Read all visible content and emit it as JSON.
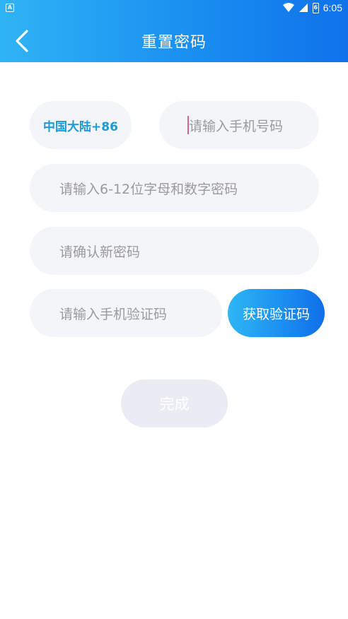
{
  "status_bar": {
    "app_badge": "A",
    "battery_level": "6",
    "time": "6:05"
  },
  "header": {
    "title": "重置密码"
  },
  "form": {
    "country_code": "中国大陆+86",
    "phone_placeholder": "请输入手机号码",
    "password_placeholder": "请输入6-12位字母和数字密码",
    "confirm_placeholder": "请确认新密码",
    "code_placeholder": "请输入手机验证码",
    "get_code_label": "获取验证码",
    "submit_label": "完成"
  },
  "colors": {
    "header_start": "#2fb4f5",
    "header_end": "#0f72ea",
    "country_text": "#1a9ad6",
    "field_bg": "#f4f5f9",
    "placeholder": "#9a9a9f",
    "disabled_button": "#ebebf4"
  }
}
